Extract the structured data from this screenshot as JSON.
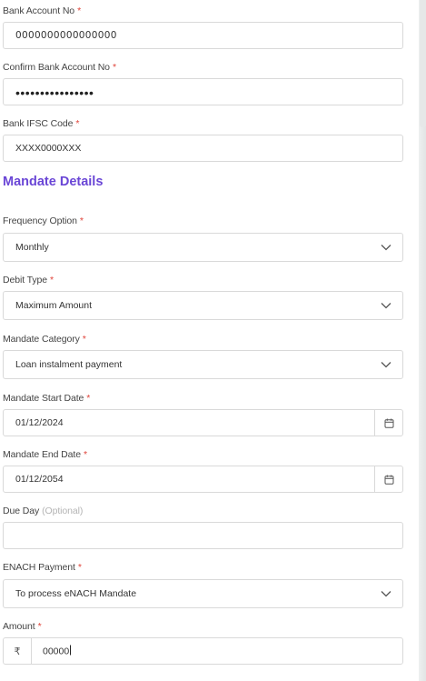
{
  "required_mark": "*",
  "bank_account": {
    "label": "Bank Account No",
    "value": "0000000000000000"
  },
  "confirm_account": {
    "label": "Confirm Bank Account No",
    "value": "••••••••••••••••"
  },
  "ifsc": {
    "label": "Bank IFSC Code",
    "value": "XXXX0000XXX"
  },
  "section": {
    "title": "Mandate Details"
  },
  "frequency": {
    "label": "Frequency Option",
    "value": "Monthly",
    "icon": "chevron-down-icon"
  },
  "debit_type": {
    "label": "Debit Type",
    "value": "Maximum Amount",
    "icon": "chevron-down-icon"
  },
  "mandate_category": {
    "label": "Mandate Category",
    "value": "Loan instalment payment",
    "icon": "chevron-down-icon"
  },
  "start_date": {
    "label": "Mandate Start Date",
    "value": "01/12/2024",
    "icon": "calendar-icon"
  },
  "end_date": {
    "label": "Mandate End Date",
    "value": "01/12/2054",
    "icon": "calendar-icon"
  },
  "due_day": {
    "label": "Due Day",
    "optional": "(Optional)",
    "value": ""
  },
  "enach": {
    "label": "ENACH Payment",
    "value": "To process eNACH Mandate",
    "icon": "chevron-down-icon"
  },
  "amount": {
    "label": "Amount",
    "currency": "₹",
    "value": "00000"
  },
  "colors": {
    "accent": "#6a46d6",
    "required": "#e0443a",
    "border": "#d9d9d9"
  }
}
